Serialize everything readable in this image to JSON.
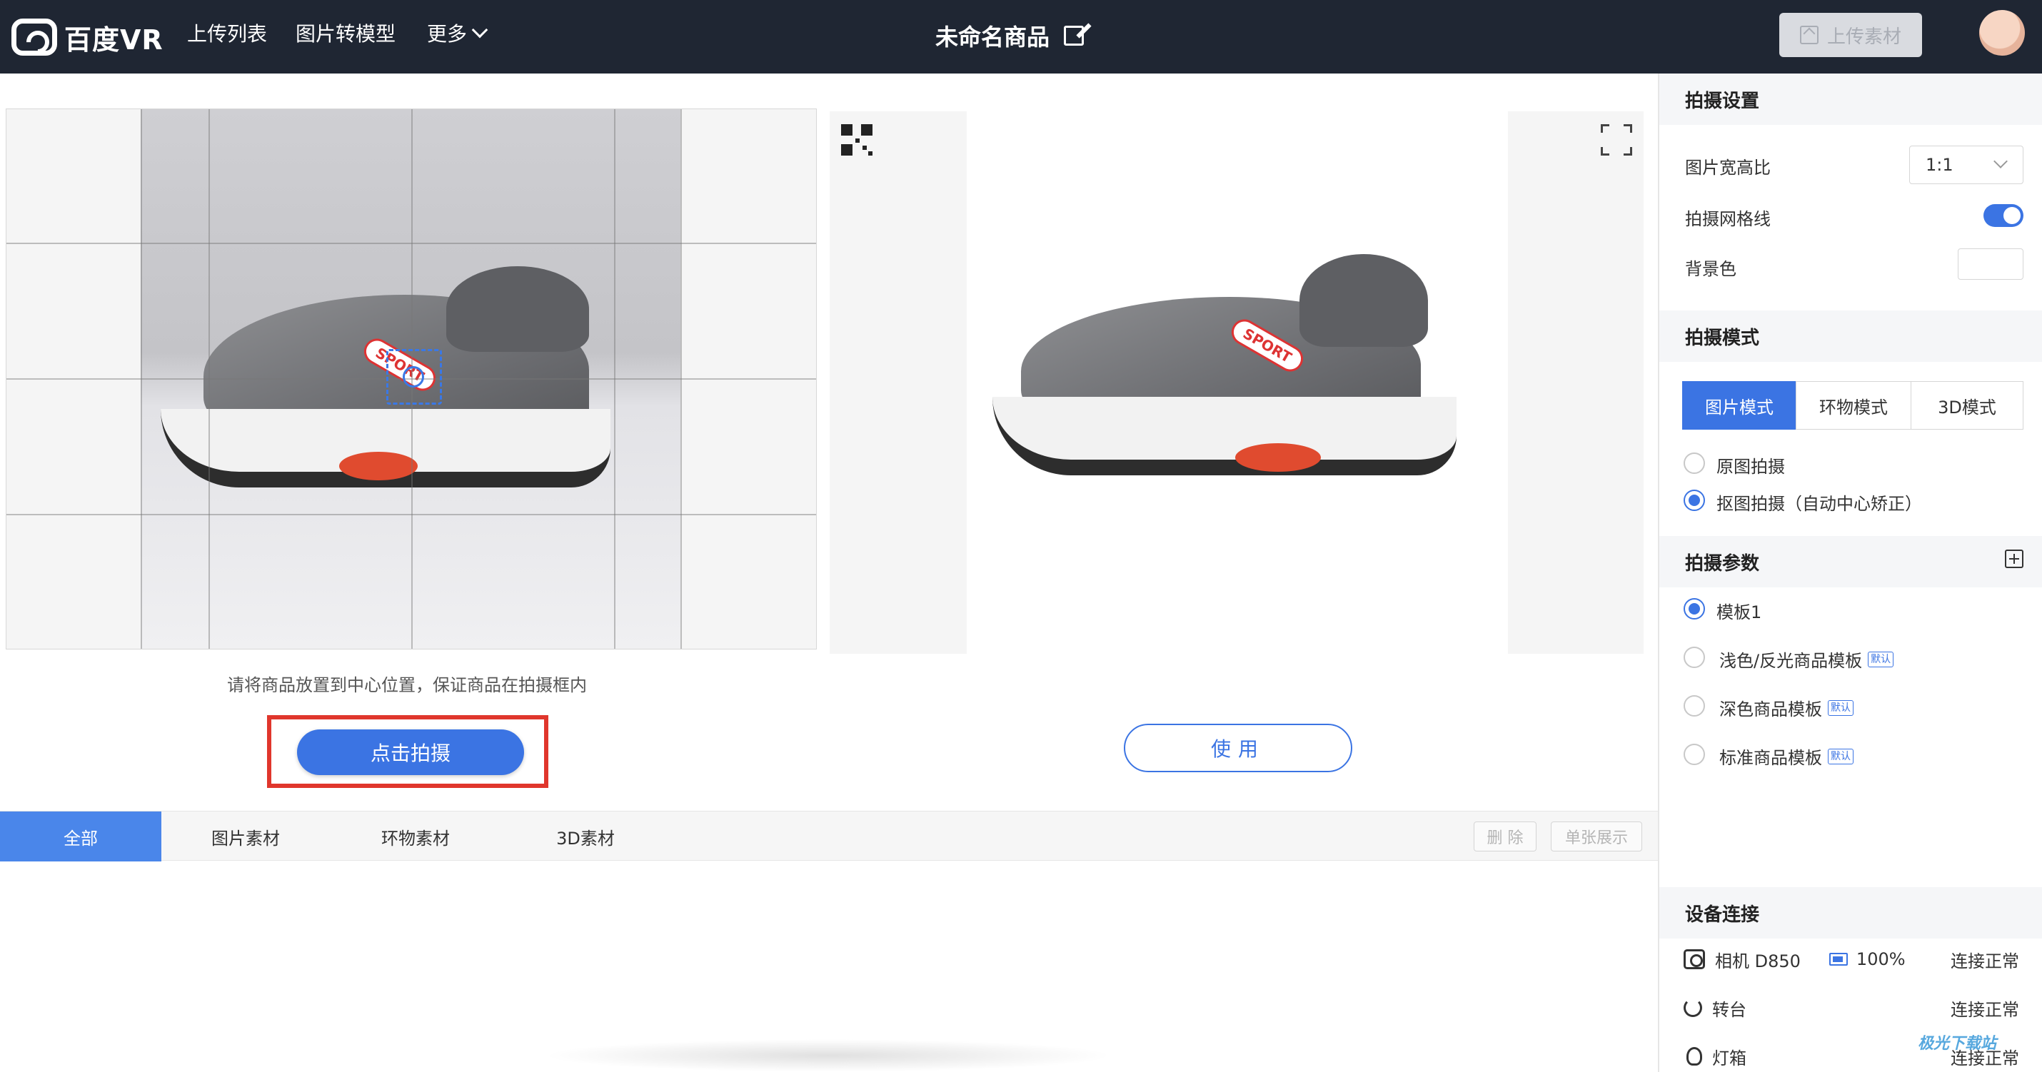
{
  "header": {
    "logo_text": "百度VR",
    "nav": [
      "上传列表",
      "图片转模型",
      "更多"
    ],
    "title": "未命名商品",
    "upload_label": "上传素材"
  },
  "capture": {
    "hint": "请将商品放置到中心位置，保证商品在拍摄框内",
    "shoot_label": "点击拍摄",
    "badge_text": "SPORT"
  },
  "preview": {
    "use_label": "使用",
    "badge_text": "SPORT"
  },
  "material_tabs": {
    "tabs": [
      "全部",
      "图片素材",
      "环物素材",
      "3D素材"
    ],
    "delete_label": "删 除",
    "single_label": "单张展示"
  },
  "panel": {
    "shoot_settings": {
      "title": "拍摄设置",
      "ratio_label": "图片宽高比",
      "ratio_value": "1:1",
      "grid_label": "拍摄网格线",
      "grid_on": true,
      "bg_label": "背景色"
    },
    "shoot_mode": {
      "title": "拍摄模式",
      "modes": [
        "图片模式",
        "环物模式",
        "3D模式"
      ],
      "options": [
        "原图拍摄",
        "抠图拍摄（自动中心矫正）"
      ]
    },
    "params": {
      "title": "拍摄参数",
      "templates": [
        "模板1",
        "浅色/反光商品模板",
        "深色商品模板",
        "标准商品模板"
      ],
      "default_tag": "默认"
    },
    "devices": {
      "title": "设备连接",
      "items": [
        {
          "name": "相机 D850",
          "battery": "100%",
          "status": "连接正常"
        },
        {
          "name": "转台",
          "status": "连接正常"
        },
        {
          "name": "灯箱",
          "status": "连接正常"
        }
      ]
    }
  },
  "watermark": "极光下载站",
  "colors": {
    "accent": "#3b74e3",
    "topbar": "#1f2633",
    "highlight": "#e0362c"
  }
}
